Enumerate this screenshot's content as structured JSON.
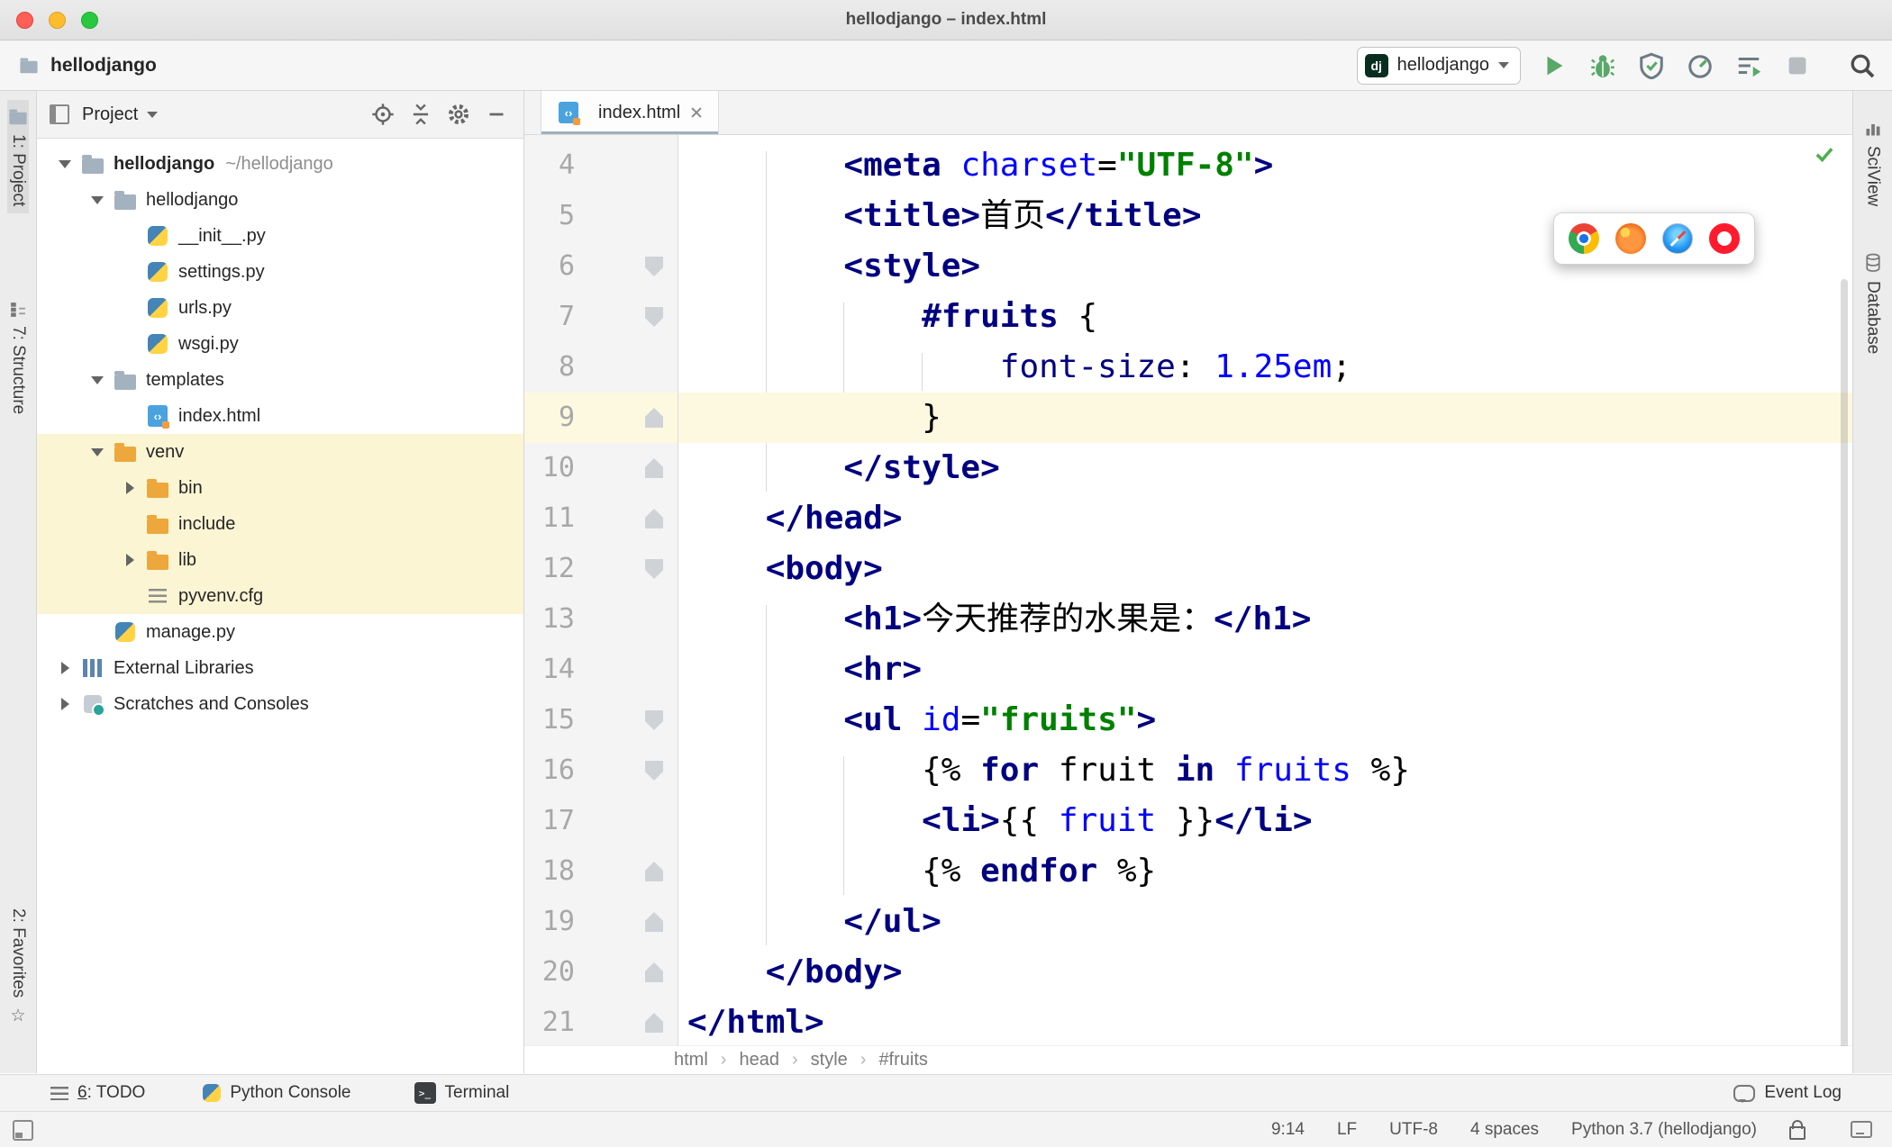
{
  "window": {
    "title": "hellodjango – index.html"
  },
  "toolbar": {
    "project_name": "hellodjango",
    "run_config": {
      "badge": "dj",
      "name": "hellodjango"
    }
  },
  "left_stripe": {
    "project": "1: Project",
    "structure": "7: Structure",
    "favorites": "2: Favorites"
  },
  "right_stripe": {
    "sciview": "SciView",
    "database": "Database"
  },
  "project_panel": {
    "title": "Project",
    "tree": [
      {
        "label": "hellodjango",
        "sublabel": "~/hellodjango",
        "icon": "folder",
        "level": 0,
        "arrow": "down",
        "bold": true
      },
      {
        "label": "hellodjango",
        "icon": "folder",
        "level": 1,
        "arrow": "down"
      },
      {
        "label": "__init__.py",
        "icon": "python",
        "level": 2
      },
      {
        "label": "settings.py",
        "icon": "python",
        "level": 2
      },
      {
        "label": "urls.py",
        "icon": "python",
        "level": 2
      },
      {
        "label": "wsgi.py",
        "icon": "python",
        "level": 2
      },
      {
        "label": "templates",
        "icon": "folder",
        "level": 1,
        "arrow": "down"
      },
      {
        "label": "index.html",
        "icon": "html",
        "level": 2
      },
      {
        "label": "venv",
        "icon": "folder-amber",
        "level": 1,
        "arrow": "down",
        "highlight": true
      },
      {
        "label": "bin",
        "icon": "folder-amber",
        "level": 2,
        "arrow": "right",
        "highlight": true
      },
      {
        "label": "include",
        "icon": "folder-amber",
        "level": 2,
        "highlight": true
      },
      {
        "label": "lib",
        "icon": "folder-amber",
        "level": 2,
        "arrow": "right",
        "highlight": true
      },
      {
        "label": "pyvenv.cfg",
        "icon": "config",
        "level": 2,
        "highlight": true
      },
      {
        "label": "manage.py",
        "icon": "python",
        "level": 1
      },
      {
        "label": "External Libraries",
        "icon": "libraries",
        "level": 0,
        "arrow": "right"
      },
      {
        "label": "Scratches and Consoles",
        "icon": "scratches",
        "level": 0,
        "arrow": "right"
      }
    ]
  },
  "editor": {
    "tab": {
      "title": "index.html"
    },
    "active_line": 9,
    "breadcrumb_sep": "›",
    "breadcrumbs": [
      "html",
      "head",
      "style",
      "#fruits"
    ],
    "browser_popup": [
      "chrome",
      "firefox",
      "safari",
      "opera"
    ],
    "guides": [
      {
        "col": 4,
        "from": 4,
        "to": 10
      },
      {
        "col": 8,
        "from": 7,
        "to": 9
      },
      {
        "col": 12,
        "from": 8,
        "to": 8
      },
      {
        "col": 4,
        "from": 13,
        "to": 19
      },
      {
        "col": 8,
        "from": 16,
        "to": 18
      }
    ],
    "lines": [
      {
        "num": 4,
        "fold": null,
        "tokens": [
          [
            "        ",
            "plain"
          ],
          [
            "<meta",
            "tag"
          ],
          [
            " ",
            "plain"
          ],
          [
            "charset",
            "attr"
          ],
          [
            "=",
            "plain"
          ],
          [
            "\"UTF-8\"",
            "string"
          ],
          [
            ">",
            "tag"
          ]
        ]
      },
      {
        "num": 5,
        "fold": null,
        "tokens": [
          [
            "        ",
            "plain"
          ],
          [
            "<title>",
            "tag"
          ],
          [
            "首页",
            "plain"
          ],
          [
            "</title>",
            "tag"
          ]
        ]
      },
      {
        "num": 6,
        "fold": "start",
        "tokens": [
          [
            "        ",
            "plain"
          ],
          [
            "<style>",
            "tag"
          ]
        ]
      },
      {
        "num": 7,
        "fold": "start",
        "tokens": [
          [
            "            ",
            "plain"
          ],
          [
            "#fruits",
            "selector"
          ],
          [
            " {",
            "plain"
          ]
        ]
      },
      {
        "num": 8,
        "fold": null,
        "tokens": [
          [
            "                ",
            "plain"
          ],
          [
            "font-size",
            "property"
          ],
          [
            ": ",
            "plain"
          ],
          [
            "1.25em",
            "number"
          ],
          [
            ";",
            "plain"
          ]
        ]
      },
      {
        "num": 9,
        "fold": "end",
        "tokens": [
          [
            "            }",
            "plain"
          ]
        ]
      },
      {
        "num": 10,
        "fold": "end",
        "tokens": [
          [
            "        ",
            "plain"
          ],
          [
            "</style>",
            "tag"
          ]
        ]
      },
      {
        "num": 11,
        "fold": "end",
        "tokens": [
          [
            "    ",
            "plain"
          ],
          [
            "</head>",
            "tag"
          ]
        ]
      },
      {
        "num": 12,
        "fold": "start",
        "tokens": [
          [
            "    ",
            "plain"
          ],
          [
            "<body>",
            "tag"
          ]
        ]
      },
      {
        "num": 13,
        "fold": null,
        "tokens": [
          [
            "        ",
            "plain"
          ],
          [
            "<h1>",
            "tag"
          ],
          [
            "今天推荐的水果是：",
            "plain"
          ],
          [
            "</h1>",
            "tag"
          ]
        ]
      },
      {
        "num": 14,
        "fold": null,
        "tokens": [
          [
            "        ",
            "plain"
          ],
          [
            "<hr>",
            "tag"
          ]
        ]
      },
      {
        "num": 15,
        "fold": "start",
        "tokens": [
          [
            "        ",
            "plain"
          ],
          [
            "<ul",
            "tag"
          ],
          [
            " ",
            "plain"
          ],
          [
            "id",
            "attr"
          ],
          [
            "=",
            "plain"
          ],
          [
            "\"fruits\"",
            "string"
          ],
          [
            ">",
            "tag"
          ]
        ]
      },
      {
        "num": 16,
        "fold": "start",
        "tokens": [
          [
            "            ",
            "plain"
          ],
          [
            "{% ",
            "brace"
          ],
          [
            "for",
            "keyword"
          ],
          [
            " fruit ",
            "plain"
          ],
          [
            "in",
            "keyword"
          ],
          [
            " ",
            "plain"
          ],
          [
            "fruits",
            "var"
          ],
          [
            " %}",
            "brace"
          ]
        ]
      },
      {
        "num": 17,
        "fold": null,
        "tokens": [
          [
            "            ",
            "plain"
          ],
          [
            "<li>",
            "tag"
          ],
          [
            "{{ ",
            "brace"
          ],
          [
            "fruit",
            "var"
          ],
          [
            " }}",
            "brace"
          ],
          [
            "</li>",
            "tag"
          ]
        ]
      },
      {
        "num": 18,
        "fold": "end",
        "tokens": [
          [
            "            ",
            "plain"
          ],
          [
            "{% ",
            "brace"
          ],
          [
            "endfor",
            "keyword"
          ],
          [
            " %}",
            "brace"
          ]
        ]
      },
      {
        "num": 19,
        "fold": "end",
        "tokens": [
          [
            "        ",
            "plain"
          ],
          [
            "</ul>",
            "tag"
          ]
        ]
      },
      {
        "num": 20,
        "fold": "end",
        "tokens": [
          [
            "    ",
            "plain"
          ],
          [
            "</body>",
            "tag"
          ]
        ]
      },
      {
        "num": 21,
        "fold": "end",
        "tokens": [
          [
            "</html>",
            "tag"
          ]
        ]
      }
    ]
  },
  "colors": {
    "tag": "#000080",
    "keyword": "#000080",
    "selector": "#000080",
    "property": "#000080",
    "attr": "#0000ff",
    "var": "#0000ff",
    "number": "#0000ff",
    "string": "#008000",
    "brace": "#000000",
    "plain": "#000000",
    "line_highlight": "#fdf8e0",
    "tree_highlight": "#fbf5d3",
    "run_green": "#59a869"
  },
  "toolwindow_bar": {
    "todo_num": "6",
    "todo_rest": ": TODO",
    "python_console": "Python Console",
    "terminal": "Terminal",
    "event_log": "Event Log"
  },
  "status_bar": {
    "caret": "9:14",
    "line_sep": "LF",
    "encoding": "UTF-8",
    "indent": "4 spaces",
    "interpreter": "Python 3.7 (hellodjango)"
  }
}
